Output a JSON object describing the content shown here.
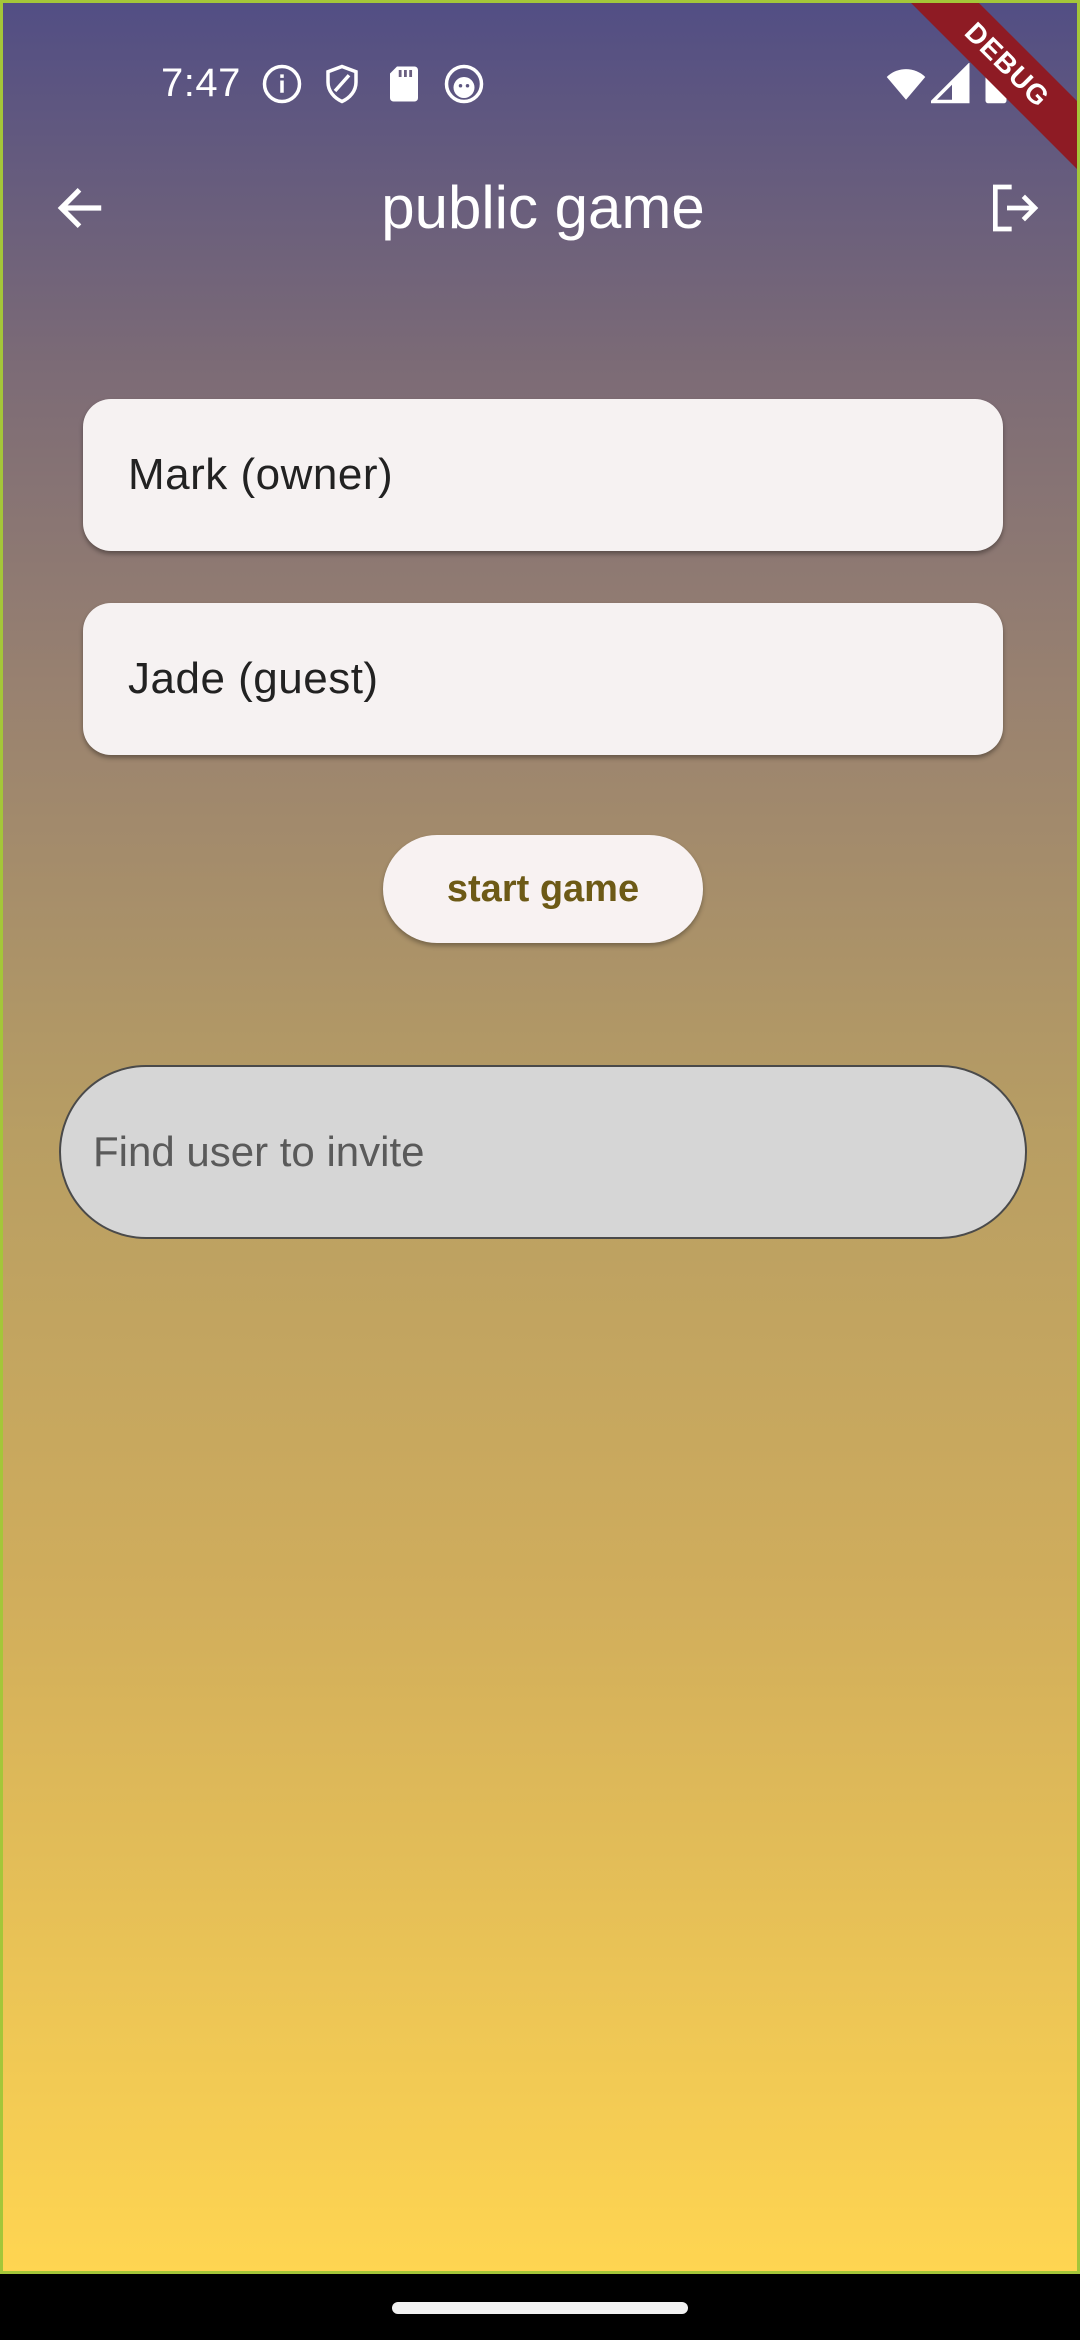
{
  "status_bar": {
    "time": "7:47",
    "icons": [
      "info-icon",
      "shield-icon",
      "sd-card-icon",
      "face-icon",
      "wifi-icon",
      "signal-icon",
      "battery-icon"
    ]
  },
  "debug_banner": {
    "label": "DEBUG",
    "color": "#8e1b24"
  },
  "app_bar": {
    "title": "public game",
    "back_icon": "arrow-left-icon",
    "exit_icon": "logout-icon"
  },
  "players": [
    {
      "label": "Mark (owner)"
    },
    {
      "label": "Jade (guest)"
    }
  ],
  "start_button": {
    "label": "start game",
    "text_color": "#6d5a16"
  },
  "invite_search": {
    "placeholder": "Find user to invite",
    "value": ""
  },
  "theme": {
    "gradient_top": "#524e84",
    "gradient_bottom": "#ffd551",
    "card_bg": "#f6f2f2"
  }
}
